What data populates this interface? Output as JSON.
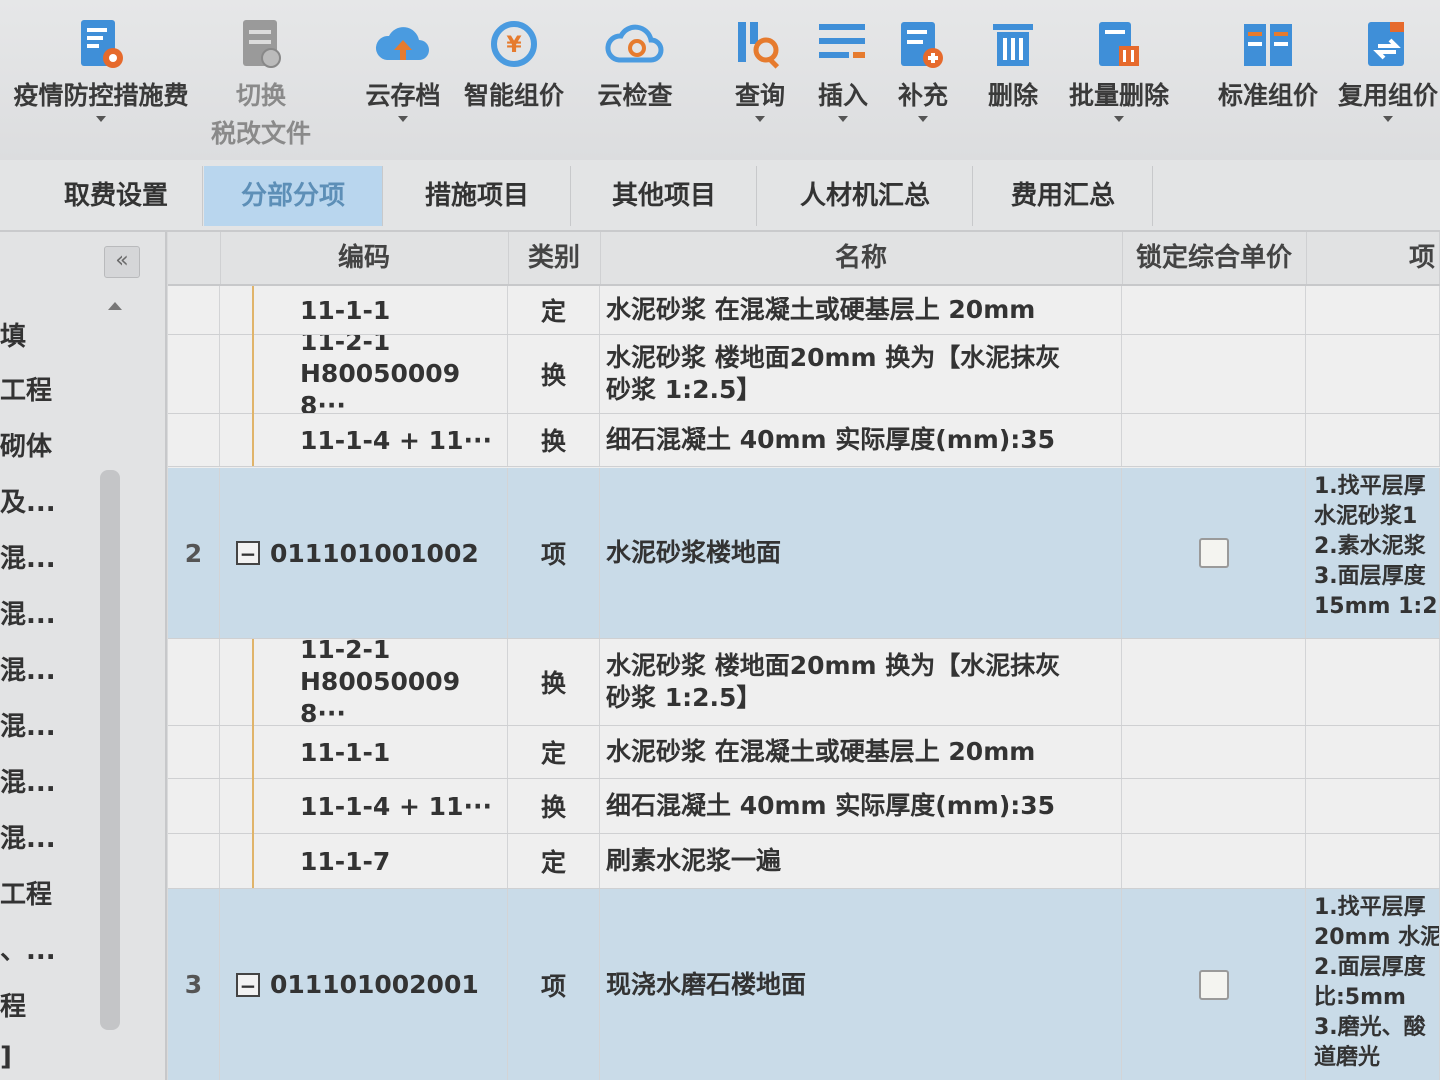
{
  "toolbar": {
    "buttons": [
      {
        "label": "疫情防控措施费",
        "sub": "",
        "caret": true
      },
      {
        "label": "切换",
        "sub": "税改文件",
        "caret": false
      },
      {
        "label": "云存档",
        "sub": "",
        "caret": true
      },
      {
        "label": "智能组价",
        "sub": "",
        "caret": false
      },
      {
        "label": "云检查",
        "sub": "",
        "caret": false
      },
      {
        "label": "查询",
        "sub": "",
        "caret": true
      },
      {
        "label": "插入",
        "sub": "",
        "caret": true
      },
      {
        "label": "补充",
        "sub": "",
        "caret": true
      },
      {
        "label": "删除",
        "sub": "",
        "caret": false
      },
      {
        "label": "批量删除",
        "sub": "",
        "caret": true
      },
      {
        "label": "标准组价",
        "sub": "",
        "caret": false
      },
      {
        "label": "复用组价",
        "sub": "",
        "caret": true
      }
    ]
  },
  "tabs": [
    {
      "label": "取费设置",
      "active": false
    },
    {
      "label": "分部分项",
      "active": true
    },
    {
      "label": "措施项目",
      "active": false
    },
    {
      "label": "其他项目",
      "active": false
    },
    {
      "label": "人材机汇总",
      "active": false
    },
    {
      "label": "费用汇总",
      "active": false
    }
  ],
  "left_panel": {
    "collapse_label": "«",
    "items": [
      "填",
      "工程",
      "砌体",
      "及...",
      "混...",
      "混...",
      "混...",
      "混...",
      "混...",
      "混...",
      "工程",
      "、...",
      "程",
      "]"
    ]
  },
  "grid": {
    "headers": {
      "code": "编码",
      "type": "类别",
      "name": "名称",
      "lock": "锁定综合单价",
      "feature": "项"
    },
    "rows": [
      {
        "kind": "sub",
        "seq": "",
        "code1": "11-1-1",
        "code2": "",
        "type": "定",
        "name1": "水泥砂浆 在混凝土或硬基层上 20mm",
        "name2": "",
        "feature": ""
      },
      {
        "kind": "sub",
        "seq": "",
        "code1": "11-2-1",
        "code2": "H80050009 8···",
        "type": "换",
        "name1": "水泥砂浆 楼地面20mm 换为【水泥抹灰",
        "name2": "砂浆 1:2.5】",
        "feature": ""
      },
      {
        "kind": "sub",
        "seq": "",
        "code1": "11-1-4 + 11···",
        "code2": "",
        "type": "换",
        "name1": "细石混凝土 40mm 实际厚度(mm):35",
        "name2": "",
        "feature": ""
      },
      {
        "kind": "item",
        "seq": "2",
        "code1": "011101001002",
        "code2": "",
        "type": "项",
        "name1": "水泥砂浆楼地面",
        "name2": "",
        "feature": "1.找平层厚\n水泥砂浆1\n2.素水泥浆\n3.面层厚度\n15mm 1:2."
      },
      {
        "kind": "sub",
        "seq": "",
        "code1": "11-2-1",
        "code2": "H80050009 8···",
        "type": "换",
        "name1": "水泥砂浆 楼地面20mm 换为【水泥抹灰",
        "name2": "砂浆 1:2.5】",
        "feature": ""
      },
      {
        "kind": "sub",
        "seq": "",
        "code1": "11-1-1",
        "code2": "",
        "type": "定",
        "name1": "水泥砂浆 在混凝土或硬基层上 20mm",
        "name2": "",
        "feature": ""
      },
      {
        "kind": "sub",
        "seq": "",
        "code1": "11-1-4 + 11···",
        "code2": "",
        "type": "换",
        "name1": "细石混凝土 40mm 实际厚度(mm):35",
        "name2": "",
        "feature": ""
      },
      {
        "kind": "sub",
        "seq": "",
        "code1": "11-1-7",
        "code2": "",
        "type": "定",
        "name1": "刷素水泥浆一遍",
        "name2": "",
        "feature": ""
      },
      {
        "kind": "item",
        "seq": "3",
        "code1": "011101002001",
        "code2": "",
        "type": "项",
        "name1": "现浇水磨石楼地面",
        "name2": "",
        "feature": "1.找平层厚\n20mm 水泥\n2.面层厚度\n比:5mm\n3.磨光、酸\n道磨光"
      }
    ]
  },
  "colors": {
    "accent_tab_bg": "#b9d6ee",
    "accent_tab_text": "#5d8fb7",
    "item_row_bg": "#c9dbe8",
    "tree_line": "#e0b46a"
  }
}
